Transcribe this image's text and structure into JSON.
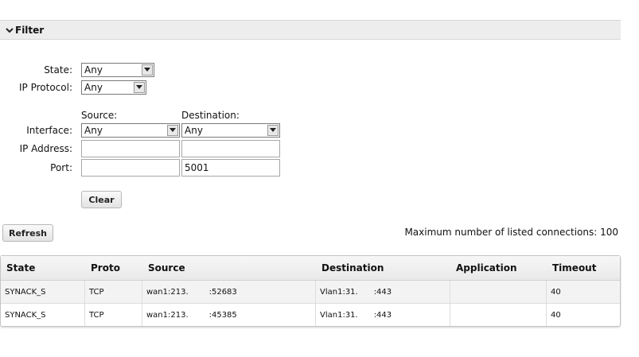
{
  "filter": {
    "title": "Filter",
    "state_label": "State:",
    "state_value": "Any",
    "protocol_label": "IP Protocol:",
    "protocol_value": "Any",
    "source_heading": "Source:",
    "destination_heading": "Destination:",
    "interface_label": "Interface:",
    "source_interface": "Any",
    "destination_interface": "Any",
    "ip_label": "IP Address:",
    "source_ip": "",
    "destination_ip": "",
    "port_label": "Port:",
    "source_port": "",
    "destination_port": "5001",
    "clear_label": "Clear"
  },
  "toolbar": {
    "refresh_label": "Refresh",
    "max_connections_text": "Maximum number of listed connections: 100"
  },
  "table": {
    "headers": [
      "State",
      "Proto",
      "Source",
      "Destination",
      "Application",
      "Timeout"
    ],
    "rows": [
      {
        "state": "SYNACK_S",
        "proto": "TCP",
        "source": "wan1:213.             :52683",
        "destination": "Vlan1:31.          :443",
        "application": "",
        "timeout": "40"
      },
      {
        "state": "SYNACK_S",
        "proto": "TCP",
        "source": "wan1:213.             :45385",
        "destination": "Vlan1:31.          :443",
        "application": "",
        "timeout": "40"
      }
    ]
  }
}
